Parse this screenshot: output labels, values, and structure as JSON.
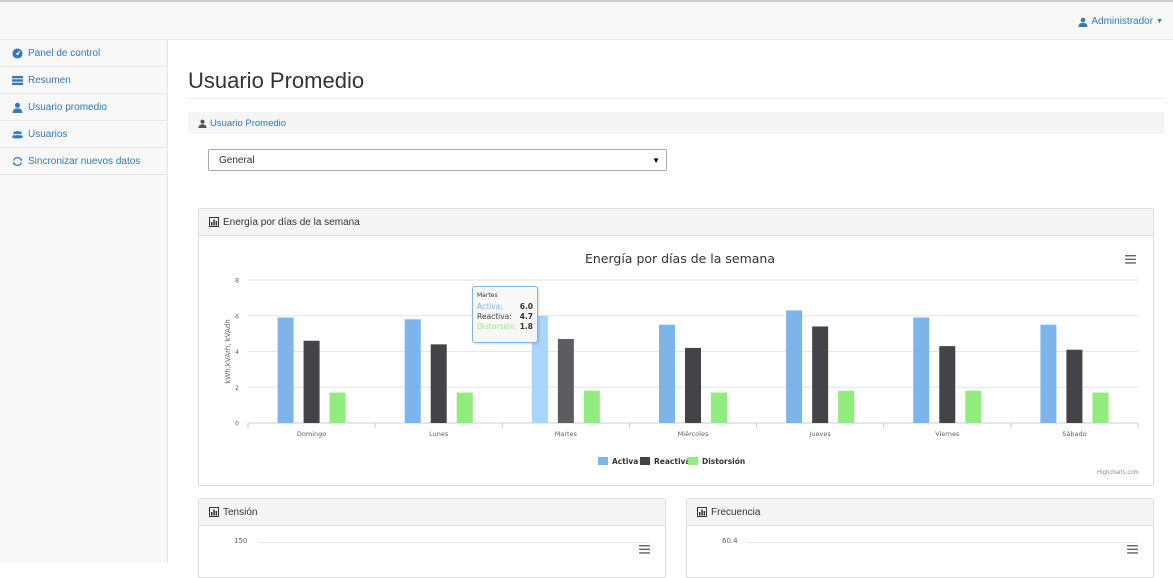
{
  "header": {
    "user_label": "Administrador"
  },
  "sidebar": {
    "items": [
      {
        "label": "Panel de control"
      },
      {
        "label": "Resumen"
      },
      {
        "label": "Usuario promedio"
      },
      {
        "label": "Usuarios"
      },
      {
        "label": "Sincronizar nuevos datos"
      }
    ]
  },
  "main": {
    "title": "Usuario Promedio",
    "breadcrumb": "Usuario Promedio",
    "select": {
      "value": "General"
    }
  },
  "panels": {
    "energia": {
      "heading": "Energía por días de la semana"
    },
    "tension": {
      "heading": "Tensión",
      "first_tick": "150"
    },
    "frecuencia": {
      "heading": "Frecuencia",
      "first_tick": "60.4"
    }
  },
  "chart_credit": "Highcharts.com",
  "tooltip": {
    "title": "Martes",
    "rows": [
      {
        "label": "Activa:",
        "value": "6.0"
      },
      {
        "label": "Reactiva:",
        "value": "4.7"
      },
      {
        "label": "Distorsión:",
        "value": "1.8"
      }
    ]
  },
  "chart_data": {
    "type": "bar",
    "title": "Energía por días de la semana",
    "xlabel": "",
    "ylabel": "kWh,kVArh, kVAdh",
    "ylim": [
      0,
      8
    ],
    "yticks": [
      0,
      2,
      4,
      6,
      8
    ],
    "categories": [
      "Domingo",
      "Lunes",
      "Martes",
      "Miércoles",
      "Jueves",
      "Viernes",
      "Sábado"
    ],
    "series": [
      {
        "name": "Activa",
        "color": "#7cb5ec",
        "values": [
          5.9,
          5.8,
          6.0,
          5.5,
          6.3,
          5.9,
          5.5
        ]
      },
      {
        "name": "Reactiva",
        "color": "#434348",
        "values": [
          4.6,
          4.4,
          4.7,
          4.2,
          5.4,
          4.3,
          4.1
        ]
      },
      {
        "name": "Distorsión",
        "color": "#90ed7d",
        "values": [
          1.7,
          1.7,
          1.8,
          1.7,
          1.8,
          1.8,
          1.7
        ]
      }
    ],
    "legend": "bottom-center",
    "grid": true
  }
}
